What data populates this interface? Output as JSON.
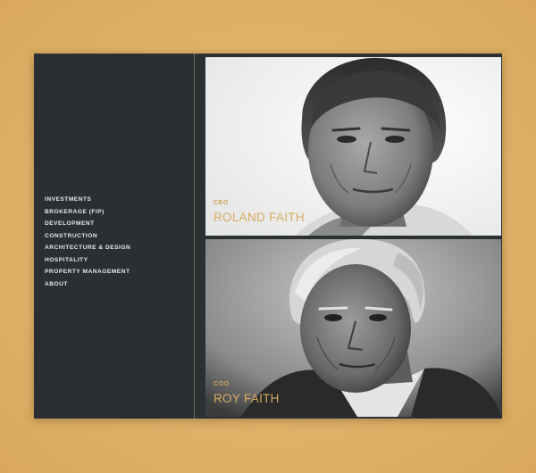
{
  "nav": {
    "items": [
      "INVESTMENTS",
      "BROKERAGE (FIP)",
      "DEVELOPMENT",
      "CONSTRUCTION",
      "ARCHITECTURE & DESIGN",
      "HOSPITALITY",
      "PROPERTY MANAGEMENT",
      "ABOUT"
    ]
  },
  "people": [
    {
      "role": "CEO",
      "name": "ROLAND FAITH"
    },
    {
      "role": "COO",
      "name": "ROY FAITH"
    }
  ],
  "colors": {
    "background": "#e1b46a",
    "sidebar": "#2a2f31",
    "accent_gold": "#d6ad60",
    "nav_text": "#e9e9e9"
  }
}
